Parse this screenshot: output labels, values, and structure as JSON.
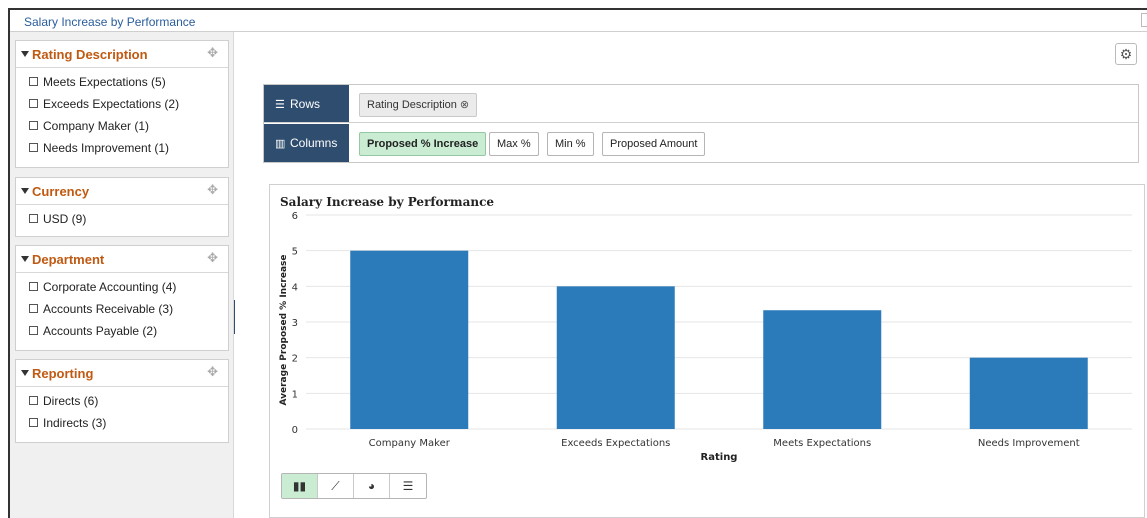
{
  "window": {
    "title": "Salary Increase by Performance"
  },
  "facets": [
    {
      "label": "Rating Description",
      "items": [
        {
          "label": "Meets Expectations (5)"
        },
        {
          "label": "Exceeds Expectations (2)"
        },
        {
          "label": "Company Maker (1)"
        },
        {
          "label": "Needs Improvement (1)"
        }
      ]
    },
    {
      "label": "Currency",
      "items": [
        {
          "label": "USD (9)"
        }
      ]
    },
    {
      "label": "Department",
      "items": [
        {
          "label": "Corporate Accounting (4)"
        },
        {
          "label": "Accounts Receivable (3)"
        },
        {
          "label": "Accounts Payable (2)"
        }
      ]
    },
    {
      "label": "Reporting",
      "items": [
        {
          "label": "Directs (6)"
        },
        {
          "label": "Indirects (3)"
        }
      ]
    }
  ],
  "pivot": {
    "rows_label": "Rows",
    "columns_label": "Columns",
    "row_fields": [
      "Rating Description"
    ],
    "column_fields": [
      "Proposed % Increase",
      "Max %",
      "Min %",
      "Proposed Amount"
    ],
    "active_column": "Proposed % Increase"
  },
  "icons": {
    "settings": "gear-icon",
    "rows": "list-icon",
    "columns": "columns-icon",
    "remove": "circle-x-icon",
    "move": "move-icon",
    "collapse": "pause-bars-icon"
  },
  "colors": {
    "bar": "#2b7bba",
    "facet_heading": "#c05a12",
    "pivot_label_bg": "#2f4d6e",
    "active_pill": "#c9ecd3",
    "title_link": "#2a5d9c"
  },
  "chart_types": [
    "bar",
    "line",
    "pie",
    "horizontal-bar"
  ],
  "active_chart_type": "bar",
  "chart_data": {
    "type": "bar",
    "title": "Salary Increase by Performance",
    "xlabel": "Rating",
    "ylabel": "Average Proposed % Increase",
    "categories": [
      "Company Maker",
      "Exceeds Expectations",
      "Meets Expectations",
      "Needs Improvement"
    ],
    "values": [
      5,
      4,
      3.33,
      2
    ],
    "ylim": [
      0,
      6
    ],
    "yticks": [
      0,
      1,
      2,
      3,
      4,
      5,
      6
    ],
    "grid": true,
    "legend": "none"
  }
}
